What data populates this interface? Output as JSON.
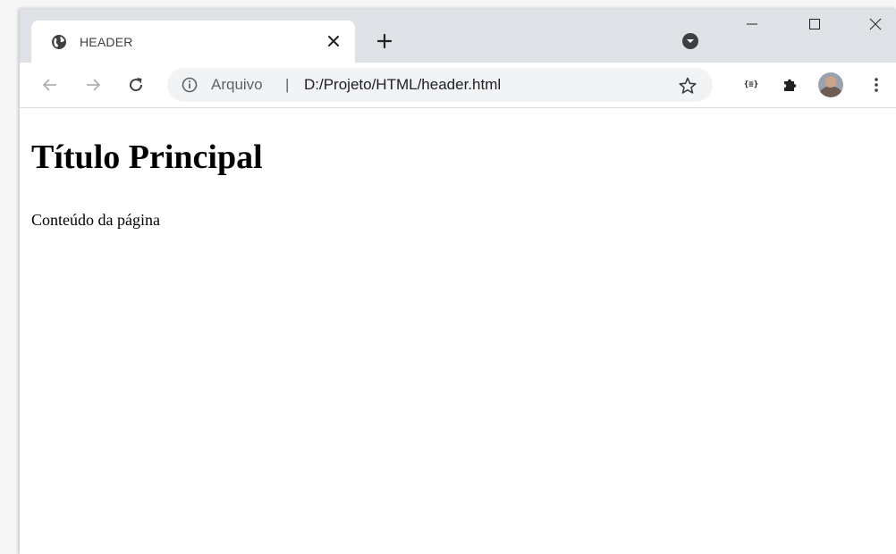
{
  "browser": {
    "tab": {
      "title": "HEADER",
      "favicon": "globe-icon",
      "close_glyph": "×"
    },
    "new_tab_glyph": "+",
    "window_controls": {
      "minimize": "minimize-icon",
      "maximize": "maximize-icon",
      "close": "close-icon"
    },
    "toolbar": {
      "back": "back-arrow-icon",
      "forward": "forward-arrow-icon",
      "reload": "reload-icon",
      "extension_json_label": "{≡}"
    },
    "address_bar": {
      "scheme_label": "Arquivo",
      "separator": "|",
      "url": "D:/Projeto/HTML/header.html"
    }
  },
  "page": {
    "heading": "Título Principal",
    "paragraph": "Conteúdo da página"
  },
  "colors": {
    "tabstrip": "#dee1e6",
    "omnibox": "#f1f3f4",
    "icon": "#5f6368"
  }
}
